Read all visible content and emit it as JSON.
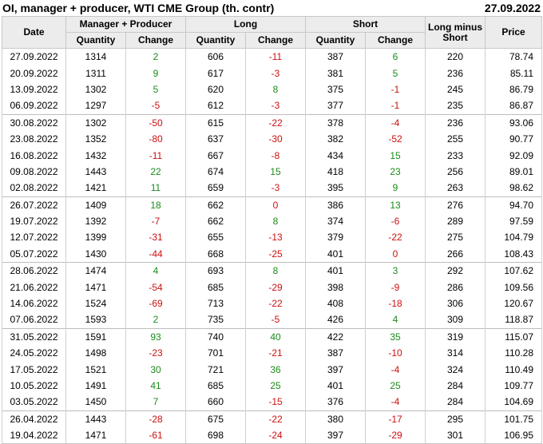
{
  "header": {
    "title": "OI, manager + producer, WTI CME Group (th. contr)",
    "date": "27.09.2022"
  },
  "columns": {
    "date": "Date",
    "group_mp": "Manager + Producer",
    "group_long": "Long",
    "group_short": "Short",
    "long_minus_short": "Long minus Short",
    "price": "Price",
    "quantity": "Quantity",
    "change": "Change"
  },
  "rows": [
    {
      "date": "27.09.2022",
      "mp_q": "1314",
      "mp_c": "2",
      "l_q": "606",
      "l_c": "-11",
      "s_q": "387",
      "s_c": "6",
      "lms": "220",
      "price": "78.74",
      "month_start": false
    },
    {
      "date": "20.09.2022",
      "mp_q": "1311",
      "mp_c": "9",
      "l_q": "617",
      "l_c": "-3",
      "s_q": "381",
      "s_c": "5",
      "lms": "236",
      "price": "85.11",
      "month_start": false
    },
    {
      "date": "13.09.2022",
      "mp_q": "1302",
      "mp_c": "5",
      "l_q": "620",
      "l_c": "8",
      "s_q": "375",
      "s_c": "-1",
      "lms": "245",
      "price": "86.79",
      "month_start": false
    },
    {
      "date": "06.09.2022",
      "mp_q": "1297",
      "mp_c": "-5",
      "l_q": "612",
      "l_c": "-3",
      "s_q": "377",
      "s_c": "-1",
      "lms": "235",
      "price": "86.87",
      "month_start": false
    },
    {
      "date": "30.08.2022",
      "mp_q": "1302",
      "mp_c": "-50",
      "l_q": "615",
      "l_c": "-22",
      "s_q": "378",
      "s_c": "-4",
      "lms": "236",
      "price": "93.06",
      "month_start": true
    },
    {
      "date": "23.08.2022",
      "mp_q": "1352",
      "mp_c": "-80",
      "l_q": "637",
      "l_c": "-30",
      "s_q": "382",
      "s_c": "-52",
      "lms": "255",
      "price": "90.77",
      "month_start": false
    },
    {
      "date": "16.08.2022",
      "mp_q": "1432",
      "mp_c": "-11",
      "l_q": "667",
      "l_c": "-8",
      "s_q": "434",
      "s_c": "15",
      "lms": "233",
      "price": "92.09",
      "month_start": false
    },
    {
      "date": "09.08.2022",
      "mp_q": "1443",
      "mp_c": "22",
      "l_q": "674",
      "l_c": "15",
      "s_q": "418",
      "s_c": "23",
      "lms": "256",
      "price": "89.01",
      "month_start": false
    },
    {
      "date": "02.08.2022",
      "mp_q": "1421",
      "mp_c": "11",
      "l_q": "659",
      "l_c": "-3",
      "s_q": "395",
      "s_c": "9",
      "lms": "263",
      "price": "98.62",
      "month_start": false
    },
    {
      "date": "26.07.2022",
      "mp_q": "1409",
      "mp_c": "18",
      "l_q": "662",
      "l_c": "0",
      "s_q": "386",
      "s_c": "13",
      "lms": "276",
      "price": "94.70",
      "month_start": true
    },
    {
      "date": "19.07.2022",
      "mp_q": "1392",
      "mp_c": "-7",
      "l_q": "662",
      "l_c": "8",
      "s_q": "374",
      "s_c": "-6",
      "lms": "289",
      "price": "97.59",
      "month_start": false
    },
    {
      "date": "12.07.2022",
      "mp_q": "1399",
      "mp_c": "-31",
      "l_q": "655",
      "l_c": "-13",
      "s_q": "379",
      "s_c": "-22",
      "lms": "275",
      "price": "104.79",
      "month_start": false
    },
    {
      "date": "05.07.2022",
      "mp_q": "1430",
      "mp_c": "-44",
      "l_q": "668",
      "l_c": "-25",
      "s_q": "401",
      "s_c": "0",
      "lms": "266",
      "price": "108.43",
      "month_start": false
    },
    {
      "date": "28.06.2022",
      "mp_q": "1474",
      "mp_c": "4",
      "l_q": "693",
      "l_c": "8",
      "s_q": "401",
      "s_c": "3",
      "lms": "292",
      "price": "107.62",
      "month_start": true
    },
    {
      "date": "21.06.2022",
      "mp_q": "1471",
      "mp_c": "-54",
      "l_q": "685",
      "l_c": "-29",
      "s_q": "398",
      "s_c": "-9",
      "lms": "286",
      "price": "109.56",
      "month_start": false
    },
    {
      "date": "14.06.2022",
      "mp_q": "1524",
      "mp_c": "-69",
      "l_q": "713",
      "l_c": "-22",
      "s_q": "408",
      "s_c": "-18",
      "lms": "306",
      "price": "120.67",
      "month_start": false
    },
    {
      "date": "07.06.2022",
      "mp_q": "1593",
      "mp_c": "2",
      "l_q": "735",
      "l_c": "-5",
      "s_q": "426",
      "s_c": "4",
      "lms": "309",
      "price": "118.87",
      "month_start": false
    },
    {
      "date": "31.05.2022",
      "mp_q": "1591",
      "mp_c": "93",
      "l_q": "740",
      "l_c": "40",
      "s_q": "422",
      "s_c": "35",
      "lms": "319",
      "price": "115.07",
      "month_start": true
    },
    {
      "date": "24.05.2022",
      "mp_q": "1498",
      "mp_c": "-23",
      "l_q": "701",
      "l_c": "-21",
      "s_q": "387",
      "s_c": "-10",
      "lms": "314",
      "price": "110.28",
      "month_start": false
    },
    {
      "date": "17.05.2022",
      "mp_q": "1521",
      "mp_c": "30",
      "l_q": "721",
      "l_c": "36",
      "s_q": "397",
      "s_c": "-4",
      "lms": "324",
      "price": "110.49",
      "month_start": false
    },
    {
      "date": "10.05.2022",
      "mp_q": "1491",
      "mp_c": "41",
      "l_q": "685",
      "l_c": "25",
      "s_q": "401",
      "s_c": "25",
      "lms": "284",
      "price": "109.77",
      "month_start": false
    },
    {
      "date": "03.05.2022",
      "mp_q": "1450",
      "mp_c": "7",
      "l_q": "660",
      "l_c": "-15",
      "s_q": "376",
      "s_c": "-4",
      "lms": "284",
      "price": "104.69",
      "month_start": false
    },
    {
      "date": "26.04.2022",
      "mp_q": "1443",
      "mp_c": "-28",
      "l_q": "675",
      "l_c": "-22",
      "s_q": "380",
      "s_c": "-17",
      "lms": "295",
      "price": "101.75",
      "month_start": true
    },
    {
      "date": "19.04.2022",
      "mp_q": "1471",
      "mp_c": "-61",
      "l_q": "698",
      "l_c": "-24",
      "s_q": "397",
      "s_c": "-29",
      "lms": "301",
      "price": "106.95",
      "month_start": false
    }
  ],
  "colors": {
    "positive": "#1a8c1a",
    "negative": "#cc1111",
    "header_bg": "#ececec"
  }
}
